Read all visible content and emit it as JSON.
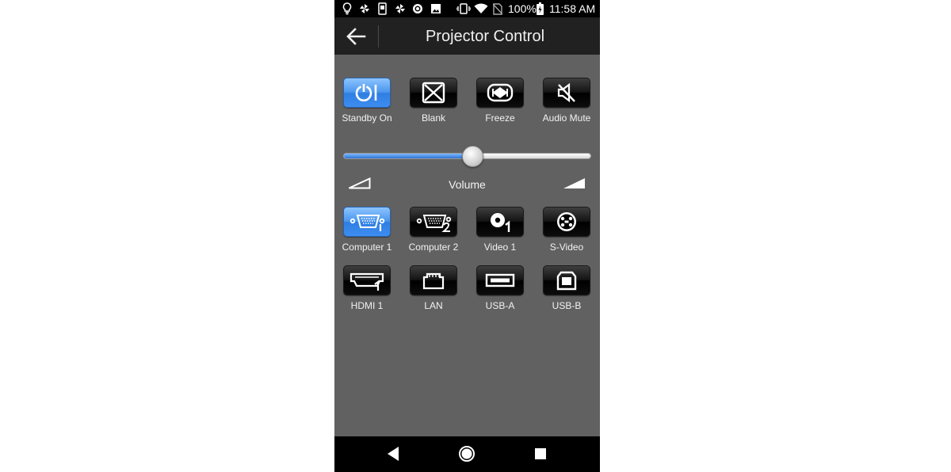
{
  "status_bar": {
    "battery": "100%",
    "time": "11:58 AM",
    "icons": [
      "lightbulb-icon",
      "pinwheel-icon",
      "phone-doc-icon",
      "pinwheel-icon",
      "circle-app-icon",
      "image-icon",
      "vibrate-icon",
      "wifi-icon",
      "no-sim-icon",
      "battery-charging-icon"
    ]
  },
  "app_bar": {
    "title": "Projector Control"
  },
  "controls": [
    {
      "label": "Standby On",
      "icon": "power-icon",
      "active": true
    },
    {
      "label": "Blank",
      "icon": "blank-icon",
      "active": false
    },
    {
      "label": "Freeze",
      "icon": "freeze-icon",
      "active": false
    },
    {
      "label": "Audio Mute",
      "icon": "audio-mute-icon",
      "active": false
    }
  ],
  "volume": {
    "label": "Volume",
    "level": 0.52
  },
  "inputs": [
    {
      "label": "Computer 1",
      "icon": "vga-1-icon",
      "active": true
    },
    {
      "label": "Computer 2",
      "icon": "vga-2-icon",
      "active": false
    },
    {
      "label": "Video 1",
      "icon": "video-1-icon",
      "active": false
    },
    {
      "label": "S-Video",
      "icon": "s-video-icon",
      "active": false
    },
    {
      "label": "HDMI 1",
      "icon": "hdmi-1-icon",
      "active": false
    },
    {
      "label": "LAN",
      "icon": "lan-icon",
      "active": false
    },
    {
      "label": "USB-A",
      "icon": "usb-a-icon",
      "active": false
    },
    {
      "label": "USB-B",
      "icon": "usb-b-icon",
      "active": false
    }
  ],
  "colors": {
    "active_blue": "#3d8cf0",
    "panel_gray": "#616161",
    "app_bar": "#212121"
  }
}
